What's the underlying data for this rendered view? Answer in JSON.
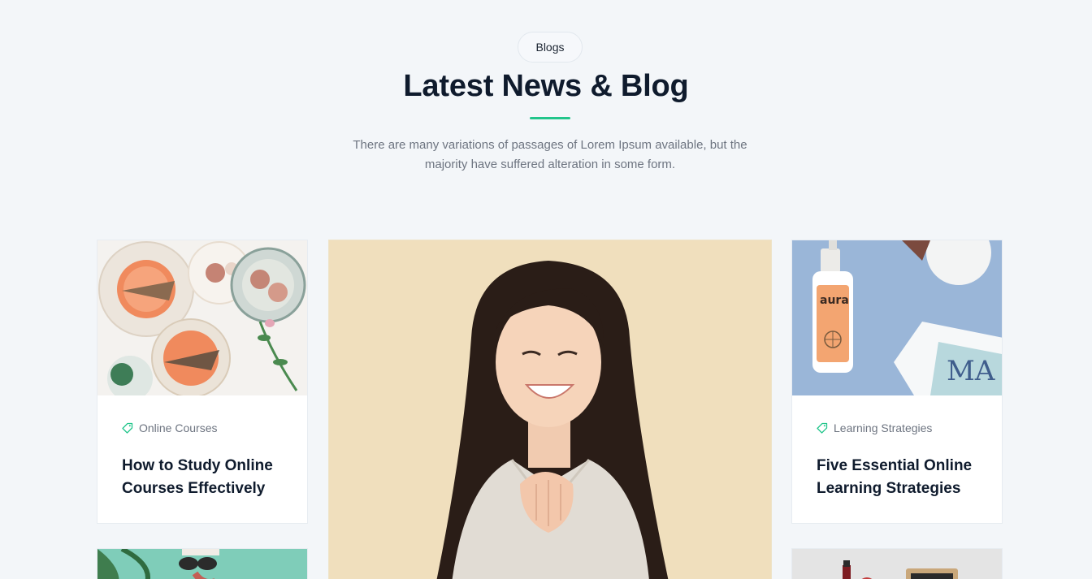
{
  "section": {
    "badge": "Blogs",
    "title": "Latest News & Blog",
    "description": "There are many variations of passages of Lorem Ipsum available, but the majority have suffered alteration in some form."
  },
  "posts": [
    {
      "category": "Online Courses",
      "title": "How to Study Online Courses Effectively",
      "image": "food-plates-photo"
    },
    {
      "image": "smiling-woman-photo"
    },
    {
      "category": "Learning Strategies",
      "title": "Five Essential Online Learning Strategies",
      "image": "aura-bottle-magazine-photo"
    },
    {
      "image": "plant-sunglasses-photo"
    },
    {
      "image": "desk-items-photo"
    }
  ],
  "colors": {
    "accent": "#22c58b",
    "heading": "#0f1b2d",
    "muted": "#6d7480",
    "background": "#f3f6f9"
  }
}
